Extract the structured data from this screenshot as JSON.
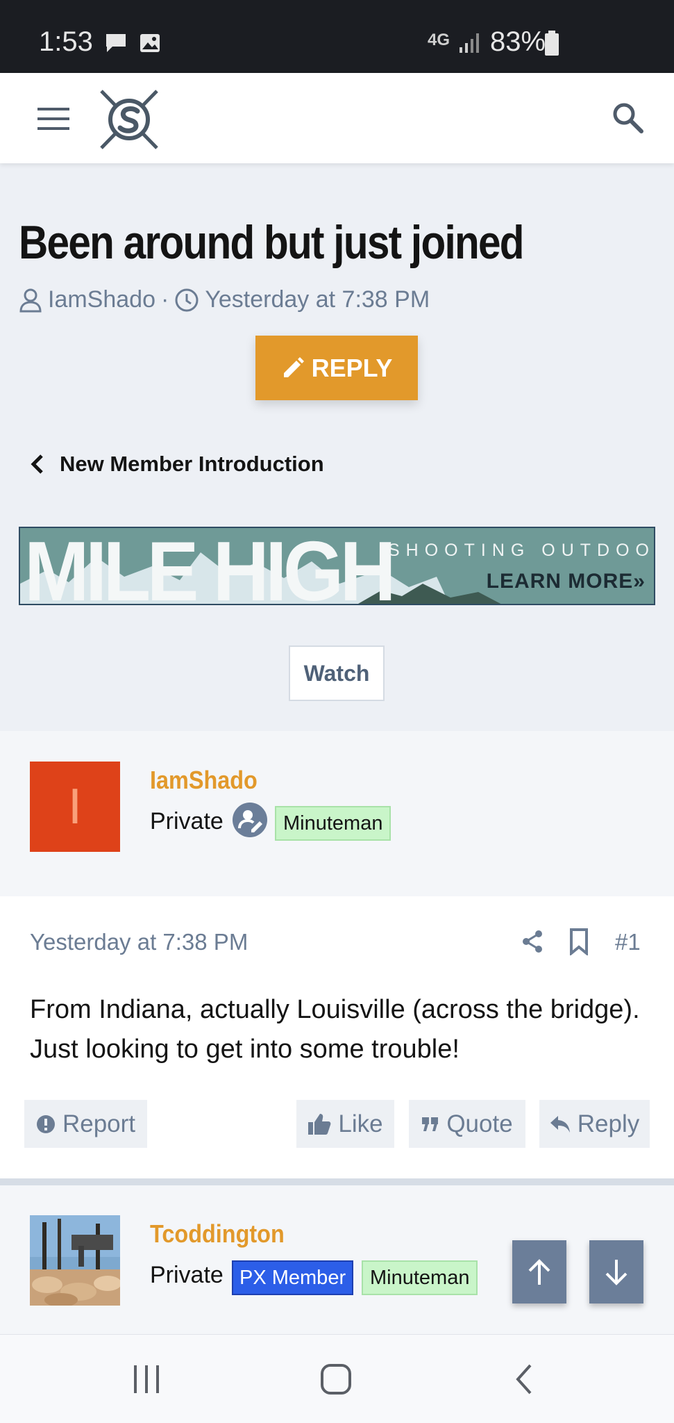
{
  "status_bar": {
    "time": "1:53",
    "network": "4G",
    "battery": "83%"
  },
  "app_bar": {
    "menu_icon": "hamburger-icon",
    "logo_icon": "site-logo",
    "search_icon": "search-icon"
  },
  "thread": {
    "title": "Been around but just joined",
    "author": "IamShado",
    "separator": "·",
    "date": "Yesterday at 7:38 PM",
    "reply_label": "REPLY",
    "breadcrumb": "New Member Introduction",
    "watch_label": "Watch"
  },
  "ad_banner": {
    "headline": "MILE HIGH",
    "tagline": "SHOOTING OUTDOORS",
    "cta": "LEARN MORE»"
  },
  "posts": [
    {
      "username": "IamShado",
      "avatar_letter": "I",
      "avatar_color": "#de4219",
      "role": "Private",
      "badges": [
        "Minuteman"
      ],
      "date": "Yesterday at 7:38 PM",
      "number": "#1",
      "body": "From Indiana, actually Louisville (across the bridge). Just looking to get into some trouble!",
      "actions": {
        "report": "Report",
        "like": "Like",
        "quote": "Quote",
        "reply": "Reply"
      }
    },
    {
      "username": "Tcoddington",
      "role": "Private",
      "badges": [
        "PX Member",
        "Minuteman"
      ]
    }
  ],
  "colors": {
    "accent": "#e2992b",
    "username": "#e2992b",
    "badge_green": "#c9f5c9",
    "badge_blue": "#2c5ee8",
    "scroll_button": "#6b7e99"
  }
}
